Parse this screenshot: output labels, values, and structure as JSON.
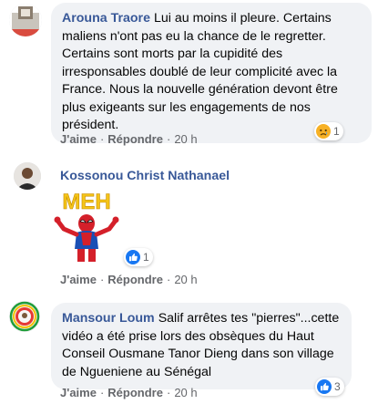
{
  "comments": [
    {
      "author": "Arouna Traore",
      "text": "Lui au moins il pleure. Certains maliens n'ont pas eu la chance de le regretter. Certains sont morts par la cupidité des irresponsables doublé de leur complicité avec la France. Nous la nouvelle génération devont être plus exigeants sur les engagements de nos président.",
      "like": "J'aime",
      "reply": "Répondre",
      "time": "20 h",
      "reaction_icon": "sad-emoji-icon",
      "reaction_count": "1"
    },
    {
      "author": "Kossonou Christ Nathanael",
      "sticker_text": "MEH",
      "like": "J'aime",
      "reply": "Répondre",
      "time": "20 h",
      "reaction_icon": "like-icon",
      "reaction_count": "1"
    },
    {
      "author": "Mansour Loum",
      "text": "Salif arrêtes tes \"pierres\"...cette vidéo a été prise lors des obsèques du Haut Conseil Ousmane Tanor Dieng dans son village de Ngueniene au Sénégal",
      "like": "J'aime",
      "reply": "Répondre",
      "time": "20 h",
      "reaction_icon": "like-icon",
      "reaction_count": "3"
    }
  ],
  "colors": {
    "author": "#385898",
    "bubble": "#f0f2f5",
    "meta": "#65676b",
    "like_blue": "#1877f2",
    "sticker_yellow": "#f5c518"
  }
}
